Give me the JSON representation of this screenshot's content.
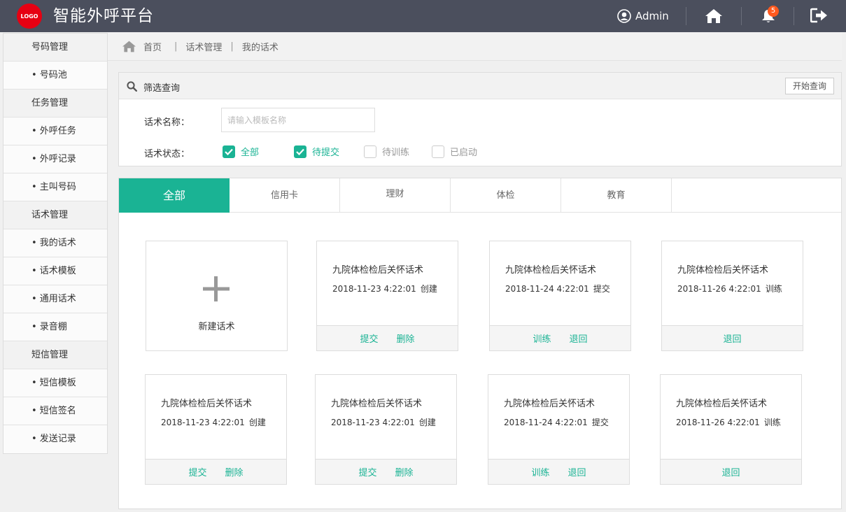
{
  "header": {
    "logo_text": "LOGO",
    "app_title": "智能外呼平台",
    "user_name": "Admin",
    "notification_count": "5",
    "icons": [
      "user-icon",
      "home-icon",
      "bell-icon",
      "logout-icon"
    ]
  },
  "sidebar": {
    "groups": [
      {
        "label": "号码管理",
        "items": [
          "• 号码池"
        ]
      },
      {
        "label": "任务管理",
        "items": [
          "• 外呼任务",
          "• 外呼记录",
          "• 主叫号码"
        ]
      },
      {
        "label": "话术管理",
        "items": [
          "• 我的话术",
          "• 话术模板",
          "• 通用话术",
          "• 录音棚"
        ]
      },
      {
        "label": "短信管理",
        "items": [
          "• 短信模板",
          "• 短信签名",
          "• 发送记录"
        ]
      }
    ]
  },
  "breadcrumb": {
    "home": "首页",
    "level1": "话术管理",
    "level2": "我的话术"
  },
  "filter": {
    "title": "筛选查询",
    "query_button": "开始查询",
    "name_label": "话术名称：",
    "name_placeholder": "请输入模板名称",
    "name_value": "",
    "status_label": "话术状态：",
    "status_options": [
      {
        "label": "全部",
        "checked": true
      },
      {
        "label": "待提交",
        "checked": true
      },
      {
        "label": "待训练",
        "checked": false
      },
      {
        "label": "已启动",
        "checked": false
      }
    ]
  },
  "tabs": [
    "全部",
    "信用卡",
    "理财",
    "体检",
    "教育"
  ],
  "active_tab": "全部",
  "new_card_label": "新建话术",
  "cards": [
    {
      "title": "九院体检检后关怀话术",
      "datetime": "2018-11-23 4:22:01",
      "status": "创建",
      "actions": [
        "提交",
        "删除"
      ]
    },
    {
      "title": "九院体检检后关怀话术",
      "datetime": "2018-11-24 4:22:01",
      "status": "提交",
      "actions": [
        "训练",
        "退回"
      ]
    },
    {
      "title": "九院体检检后关怀话术",
      "datetime": "2018-11-26 4:22:01",
      "status": "训练",
      "actions": [
        "退回"
      ]
    },
    {
      "title": "九院体检检后关怀话术",
      "datetime": "2018-11-23 4:22:01",
      "status": "创建",
      "actions": [
        "提交",
        "删除"
      ]
    },
    {
      "title": "九院体检检后关怀话术",
      "datetime": "2018-11-23 4:22:01",
      "status": "创建",
      "actions": [
        "提交",
        "删除"
      ]
    },
    {
      "title": "九院体检检后关怀话术",
      "datetime": "2018-11-24 4:22:01",
      "status": "提交",
      "actions": [
        "训练",
        "退回"
      ]
    },
    {
      "title": "九院体检检后关怀话术",
      "datetime": "2018-11-26 4:22:01",
      "status": "训练",
      "actions": [
        "退回"
      ]
    }
  ],
  "colors": {
    "header_bg": "#4b4f5d",
    "accent": "#1ab394",
    "logo_red": "#e60012",
    "badge": "#ff5a1f"
  }
}
